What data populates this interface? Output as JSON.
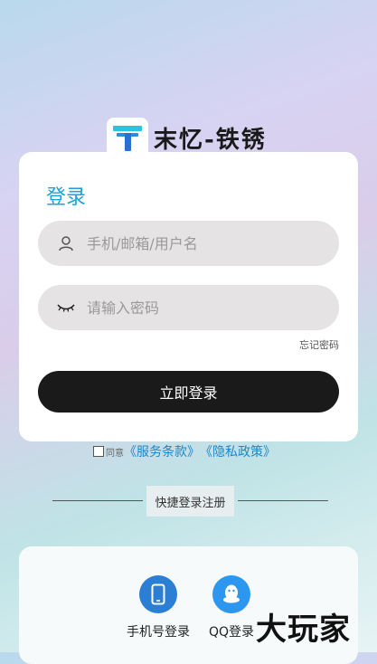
{
  "brand": {
    "name": "末忆-铁锈"
  },
  "login": {
    "title": "登录",
    "account_placeholder": "手机/邮箱/用户名",
    "password_placeholder": "请输入密码",
    "forgot": "忘记密码",
    "submit": "立即登录"
  },
  "agreement": {
    "prefix": "同意",
    "terms": "《服务条款》",
    "privacy": "《隐私政策》"
  },
  "quick_login": {
    "label": "快捷登录注册",
    "options": [
      {
        "label": "手机号登录",
        "icon": "phone-icon",
        "color": "#2a7fd4"
      },
      {
        "label": "QQ登录",
        "icon": "qq-icon",
        "color": "#2d97f0"
      }
    ]
  },
  "watermark": "大玩家",
  "colors": {
    "accent": "#1aa2e0",
    "button": "#1a1a1a",
    "link": "#1e86c8"
  }
}
